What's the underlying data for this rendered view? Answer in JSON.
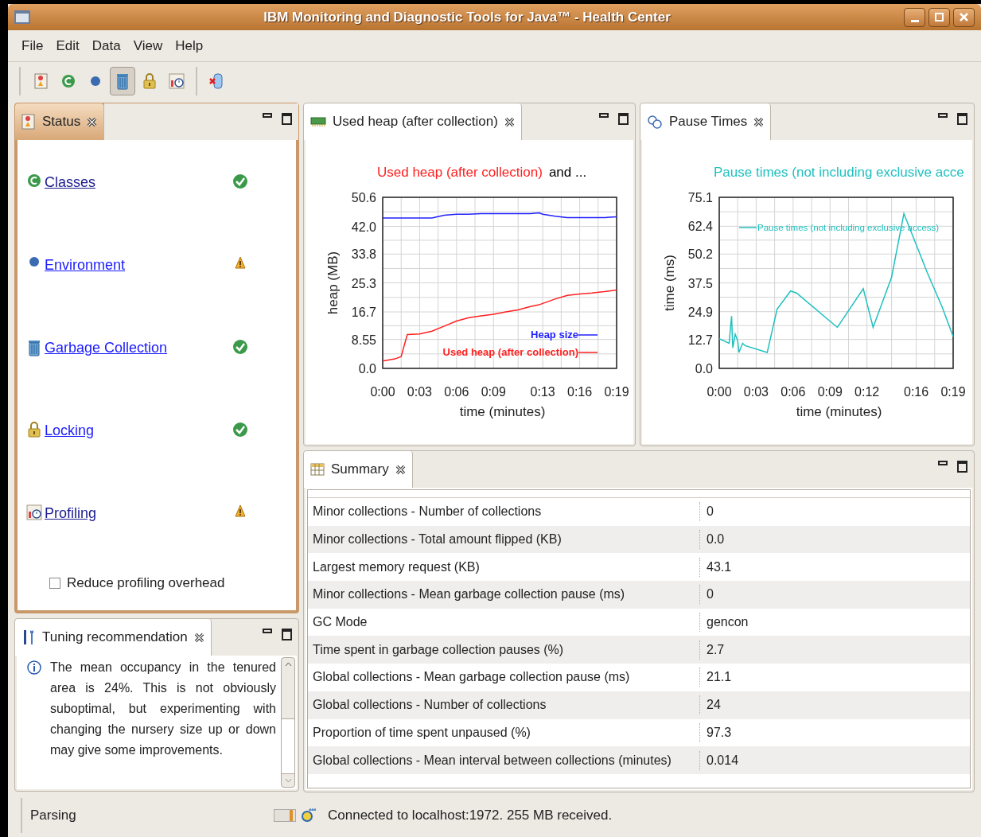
{
  "window": {
    "title": "IBM Monitoring and Diagnostic Tools for Java™ - Health Center"
  },
  "menu": [
    {
      "label": "File"
    },
    {
      "label": "Edit"
    },
    {
      "label": "Data"
    },
    {
      "label": "View"
    },
    {
      "label": "Help"
    }
  ],
  "toolbar": [
    {
      "kind": "status",
      "selected": false
    },
    {
      "kind": "classes",
      "selected": false
    },
    {
      "kind": "environment",
      "selected": false
    },
    {
      "kind": "gc",
      "selected": true
    },
    {
      "kind": "locking",
      "selected": false
    },
    {
      "kind": "profiling",
      "selected": false
    },
    {
      "kind": "disconnect",
      "selected": false
    }
  ],
  "status_panel": {
    "tab": "Status",
    "active": true,
    "items": [
      {
        "kind": "classes",
        "label": "Classes",
        "visited": true,
        "ok": true
      },
      {
        "kind": "environment",
        "label": "Environment",
        "visited": false,
        "ok": false
      },
      {
        "kind": "gc",
        "label": "Garbage Collection",
        "visited": false,
        "ok": true
      },
      {
        "kind": "locking",
        "label": "Locking",
        "visited": false,
        "ok": true
      },
      {
        "kind": "profiling",
        "label": "Profiling",
        "visited": true,
        "ok": false
      }
    ],
    "checkbox": {
      "label": "Reduce profiling overhead",
      "checked": false
    }
  },
  "tuning_panel": {
    "tab": "Tuning recommendation",
    "active": false,
    "text": "The mean occupancy in the tenured area is 24%. This is not obviously suboptimal, but experimenting with changing the nursery size up or down may give some improvements."
  },
  "heap_panel": {
    "tab": "Used heap (after collection)",
    "active": false,
    "title_parts": [
      {
        "text": "Used heap (after collection)",
        "color": "#ff2020"
      },
      {
        "text": "and  ...",
        "color": "#000000"
      }
    ],
    "chart_data": {
      "type": "line",
      "xlabel": "time (minutes)",
      "ylabel": "heap (MB)",
      "xlim": [
        0,
        19
      ],
      "ylim": [
        0,
        50.6
      ],
      "grid": true,
      "legend": true,
      "xticks": [
        {
          "value": 0,
          "label": "0:00"
        },
        {
          "value": 3,
          "label": "0:03"
        },
        {
          "value": 6,
          "label": "0:06"
        },
        {
          "value": 9,
          "label": "0:09"
        },
        {
          "value": 13,
          "label": "0:13"
        },
        {
          "value": 16,
          "label": "0:16"
        },
        {
          "value": 19,
          "label": "0:19"
        }
      ],
      "yticks": [
        {
          "value": 0,
          "label": "0.0"
        },
        {
          "value": 8.55,
          "label": "8.55"
        },
        {
          "value": 16.7,
          "label": "16.7"
        },
        {
          "value": 25.3,
          "label": "25.3"
        },
        {
          "value": 33.8,
          "label": "33.8"
        },
        {
          "value": 42,
          "label": "42.0"
        },
        {
          "value": 50.6,
          "label": "50.6"
        }
      ],
      "x": [
        0,
        1,
        1.5,
        2,
        3,
        4,
        5,
        6,
        7,
        8,
        9,
        10,
        11,
        12,
        12.7,
        13,
        14,
        15,
        16,
        17,
        18,
        19
      ],
      "series": [
        {
          "name": "Heap size",
          "color": "#2020ff",
          "values": [
            44.5,
            44.5,
            44.5,
            44.5,
            44.5,
            44.5,
            45.3,
            45.6,
            45.6,
            45.8,
            45.8,
            45.8,
            45.8,
            45.8,
            46,
            45.6,
            45,
            44.6,
            44.6,
            44.6,
            44.6,
            44.8
          ]
        },
        {
          "name": "Used heap (after collection)",
          "color": "#ff2020",
          "values": [
            2.2,
            2.8,
            3.5,
            10,
            10.2,
            11,
            12.5,
            14,
            15,
            15.5,
            16,
            16.7,
            17.3,
            18.3,
            18.8,
            19.2,
            20.5,
            21.6,
            22,
            22.3,
            22.7,
            23.2
          ]
        }
      ]
    }
  },
  "pause_panel": {
    "tab": "Pause Times",
    "active": false,
    "title_parts": [
      {
        "text": "Pause times (not including exclusive acce",
        "color": "#20c0c0"
      }
    ],
    "chart_data": {
      "type": "line",
      "xlabel": "time (minutes)",
      "ylabel": "time (ms)",
      "xlim": [
        0,
        19
      ],
      "ylim": [
        0,
        75.1
      ],
      "grid": true,
      "legend": true,
      "xticks": [
        {
          "value": 0,
          "label": "0:00"
        },
        {
          "value": 3,
          "label": "0:03"
        },
        {
          "value": 6,
          "label": "0:06"
        },
        {
          "value": 9,
          "label": "0:09"
        },
        {
          "value": 12,
          "label": "0:12"
        },
        {
          "value": 16,
          "label": "0:16"
        },
        {
          "value": 19,
          "label": "0:19"
        }
      ],
      "yticks": [
        {
          "value": 0,
          "label": "0.0"
        },
        {
          "value": 12.7,
          "label": "12.7"
        },
        {
          "value": 24.9,
          "label": "24.9"
        },
        {
          "value": 37.5,
          "label": "37.5"
        },
        {
          "value": 50.2,
          "label": "50.2"
        },
        {
          "value": 62.4,
          "label": "62.4"
        },
        {
          "value": 75.1,
          "label": "75.1"
        }
      ],
      "x": [
        0,
        0.8,
        1,
        1.1,
        1.3,
        1.5,
        1.6,
        1.9,
        2.1,
        3.9,
        4.7,
        5.8,
        6.3,
        9.6,
        11.7,
        12.5,
        14,
        15,
        15.8,
        16.9,
        18.1,
        19
      ],
      "series": [
        {
          "name": "Pause times (not including exclusive access)",
          "color": "#20c0c0",
          "values": [
            13,
            11,
            23,
            9,
            15,
            12,
            7,
            11,
            10,
            7,
            26,
            34,
            33,
            18,
            35,
            18,
            40,
            68,
            57,
            42,
            27,
            14
          ]
        }
      ]
    }
  },
  "summary_panel": {
    "tab": "Summary",
    "active": false,
    "rows": [
      {
        "label": "Minor collections - Number of collections",
        "value": "0"
      },
      {
        "label": "Minor collections - Total amount flipped (KB)",
        "value": "0.0"
      },
      {
        "label": "Largest memory request (KB)",
        "value": "43.1"
      },
      {
        "label": "Minor collections - Mean garbage collection pause (ms)",
        "value": "0"
      },
      {
        "label": "GC Mode",
        "value": "gencon"
      },
      {
        "label": "Time spent in garbage collection pauses (%)",
        "value": "2.7"
      },
      {
        "label": "Global collections - Mean garbage collection pause (ms)",
        "value": "21.1"
      },
      {
        "label": "Global collections - Number of collections",
        "value": "24"
      },
      {
        "label": "Proportion of time spent unpaused (%)",
        "value": "97.3"
      },
      {
        "label": "Global collections - Mean interval between collections (minutes)",
        "value": "0.014"
      }
    ]
  },
  "status_bar": {
    "task": "Parsing",
    "message": "Connected to localhost:1972. 255 MB received."
  }
}
